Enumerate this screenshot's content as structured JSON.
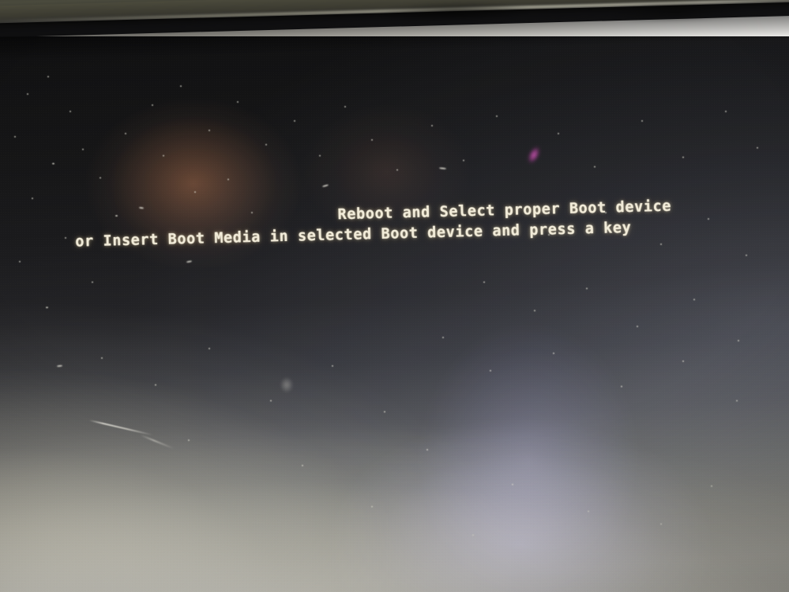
{
  "scene": {
    "kind": "photograph-of-monitor",
    "subject": "BIOS boot failure message on a computer monitor",
    "description": "Handheld photo of a dark computer screen showing a BIOS boot device error, with camera glare and reflections on the glossy panel."
  },
  "screen": {
    "background_color": "#141416",
    "text_color": "#f2ecd9",
    "message_lines": [
      "Reboot and Select proper Boot device",
      "or Insert Boot Media in selected Boot device and press a key"
    ],
    "line_1": "Reboot and Select proper Boot device",
    "line_2": "or Insert Boot Media in selected Boot device and press a key"
  },
  "bezel": {
    "edge_color": "#4a4a3d",
    "backdrop_color": "#fbfaf6"
  },
  "reflections": {
    "amber_glow_color": "#b0683e",
    "violet_glow_color": "#7e78ba",
    "magenta_flare_color": "#c452ac",
    "bottom_glare_color": "#eee6c4"
  }
}
